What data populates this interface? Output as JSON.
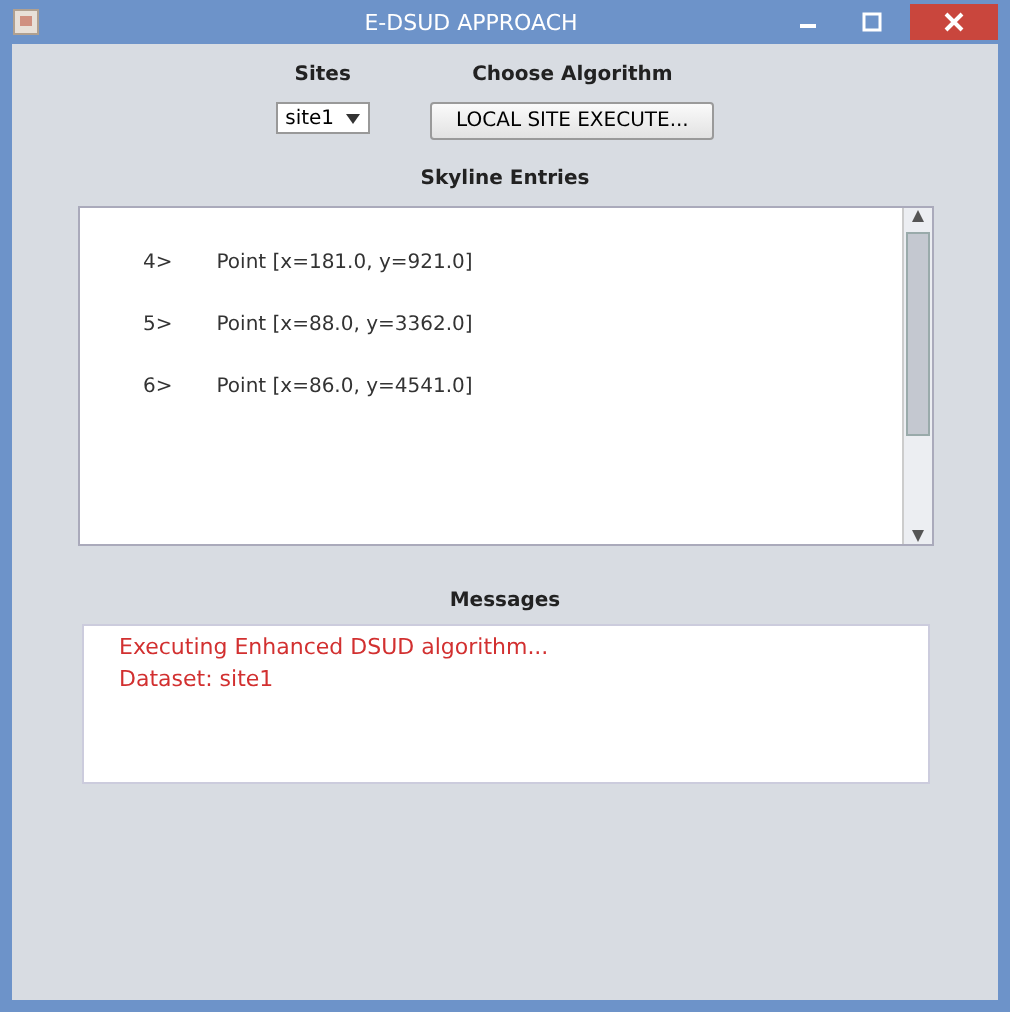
{
  "window": {
    "title": "E-DSUD APPROACH"
  },
  "sites": {
    "label": "Sites",
    "value": "site1"
  },
  "algorithm": {
    "label": "Choose Algorithm",
    "button": "LOCAL SITE EXECUTE..."
  },
  "skyline": {
    "label": "Skyline Entries",
    "entries": [
      {
        "index": "4>",
        "text": "Point [x=181.0, y=921.0]"
      },
      {
        "index": "5>",
        "text": "Point [x=88.0, y=3362.0]"
      },
      {
        "index": "6>",
        "text": "Point [x=86.0, y=4541.0]"
      }
    ]
  },
  "messages": {
    "label": "Messages",
    "lines": [
      "Executing Enhanced DSUD algorithm...",
      "Dataset: site1"
    ]
  }
}
